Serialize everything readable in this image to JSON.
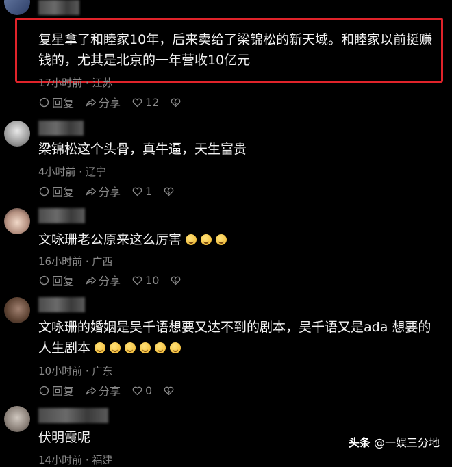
{
  "comments": [
    {
      "text": "复星拿了和睦家10年，后来卖给了梁锦松的新天域。和睦家以前挺赚钱的，尤其是北京的一年营收10亿元",
      "meta": "17小时前 · 江苏",
      "reply": "回复",
      "share": "分享",
      "likes": "12"
    },
    {
      "text": "梁锦松这个头骨，真牛逼，天生富贵",
      "meta": "4小时前 · 辽宁",
      "reply": "回复",
      "share": "分享",
      "likes": "1"
    },
    {
      "text": "文咏珊老公原来这么厉害",
      "meta": "16小时前 · 广西",
      "reply": "回复",
      "share": "分享",
      "likes": "10"
    },
    {
      "text": "文咏珊的婚姻是吴千语想要又达不到的剧本，吴千语又是ada 想要的人生剧本",
      "meta": "10小时前 · 广东",
      "reply": "回复",
      "share": "分享",
      "likes": "0"
    },
    {
      "text": "伏明霞呢",
      "meta": "14小时前 · 福建"
    }
  ],
  "watermark": {
    "brand": "头条",
    "account": "@一娱三分地"
  },
  "colors": {
    "highlight": "#e0232a",
    "meta": "#8a8a8a"
  }
}
